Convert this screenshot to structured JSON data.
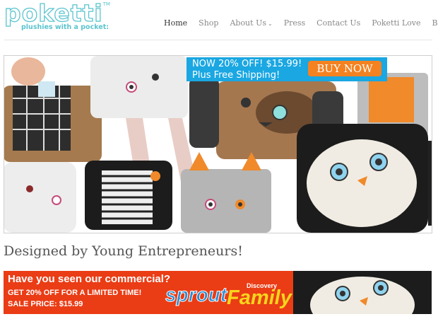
{
  "logo": {
    "word": "poketti",
    "tm": "TM",
    "tagline": "plushies with a pocket:"
  },
  "nav": {
    "items": [
      {
        "label": "Home"
      },
      {
        "label": "Shop"
      },
      {
        "label": "About Us"
      },
      {
        "label": "Press"
      },
      {
        "label": "Contact Us"
      },
      {
        "label": "Poketti Love"
      },
      {
        "label": "Blog"
      }
    ]
  },
  "hero": {
    "promo_line1": "NOW 20% OFF! $15.99!",
    "promo_line2": "Plus Free Shipping!",
    "buy_label": "BUY NOW"
  },
  "headline": "Designed by Young Entrepreneurs!",
  "banner": {
    "question": "Have you seen our commercial?",
    "offer": "GET 20% OFF FOR A LIMITED TIME!",
    "price": "SALE PRICE: $15.99",
    "sprout": "sprout",
    "discovery": "Discovery",
    "family": "Family"
  },
  "colors": {
    "brand_teal": "#5cc4cf",
    "promo_blue": "#1aa7e2",
    "buy_orange": "#f58220",
    "banner_red": "#ea3c15",
    "family_yellow": "#f7d51d"
  }
}
